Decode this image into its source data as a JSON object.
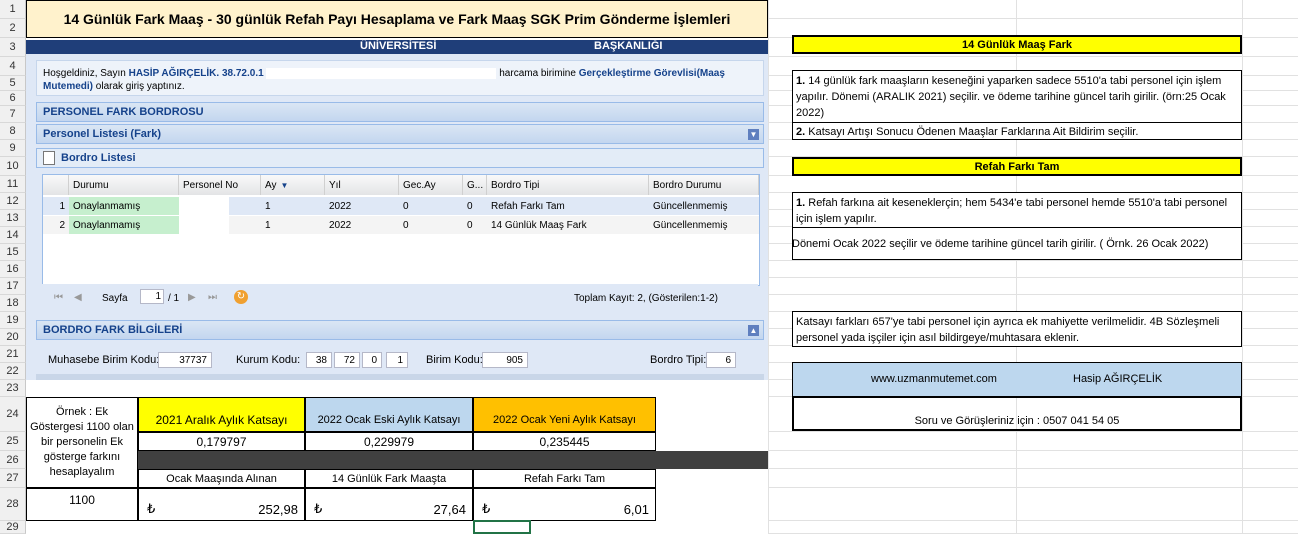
{
  "sheet_title": "14 Günlük Fark Maaş - 30 günlük Refah Payı  Hesaplama ve Fark Maaş SGK Prim Gönderme İşlemleri",
  "row_numbers": [
    "1",
    "2",
    "3",
    "4",
    "5",
    "6",
    "7",
    "8",
    "9",
    "10",
    "11",
    "12",
    "13",
    "14",
    "15",
    "16",
    "17",
    "18",
    "19",
    "20",
    "21",
    "22",
    "23",
    "24",
    "25",
    "26",
    "27",
    "28",
    "29"
  ],
  "screenshot": {
    "top_left": "ÜNİVERSİTESİ",
    "top_right": "BAŞKANLIĞI",
    "welcome_prefix": "Hoşgeldiniz, Sayın",
    "user_name": "HASİP AĞIRÇELİK. 38.72.0.1",
    "welcome_mid": "harcama birimine",
    "role": "Gerçekleştirme Görevlisi(Maaş Mutemedi)",
    "welcome_suffix": "olarak giriş yaptınız.",
    "section1": "PERSONEL FARK BORDROSU",
    "section2": "Personel Listesi (Fark)",
    "section3": "Bordro Listesi",
    "columns": [
      "Durumu",
      "Personel No",
      "Ay",
      "Yıl",
      "Gec.Ay",
      "G...",
      "Bordro Tipi",
      "Bordro Durumu"
    ],
    "rows": [
      {
        "n": "1",
        "durum": "Onaylanmamış",
        "personel": "",
        "ay": "1",
        "yil": "2022",
        "gec": "0",
        "g": "0",
        "tip": "Refah Farkı Tam",
        "bdurum": "Güncellenmemiş"
      },
      {
        "n": "2",
        "durum": "Onaylanmamış",
        "personel": "",
        "ay": "1",
        "yil": "2022",
        "gec": "0",
        "g": "0",
        "tip": "14 Günlük Maaş Fark",
        "bdurum": "Güncellenmemiş"
      }
    ],
    "pager_label": "Sayfa",
    "page_value": "1",
    "page_of": "/ 1",
    "total_text": "Toplam Kayıt: 2, (Gösterilen:1-2)",
    "section4": "BORDRO FARK BİLGİLERİ",
    "muhasebe_label": "Muhasebe Birim Kodu:",
    "muhasebe_value": "37737",
    "kurum_label": "Kurum Kodu:",
    "kurum_values": [
      "38",
      "72",
      "0",
      "1"
    ],
    "birim_label": "Birim Kodu:",
    "birim_value": "905",
    "tipi_label": "Bordro Tipi:",
    "tipi_value": "6"
  },
  "right_panel": {
    "box1_title": "14 Günlük Maaş Fark",
    "box1_item1_num": "1.",
    "box1_item1": " 14 günlük fark maaşların keseneğini yaparken sadece 5510'a tabi personel için işlem yapılır. Dönemi (ARALIK 2021) seçilir. ve ödeme tarihine güncel tarih girilir. (örn:25 Ocak 2022)",
    "box1_item2_num": "2.",
    "box1_item2": " Katsayı Artışı Sonucu Ödenen Maaşlar Farklarına Ait Bildirim seçilir.",
    "box2_title": "Refah Farkı Tam",
    "box2_item1_num": "1.",
    "box2_item1": " Refah farkına ait keseneklerçin; hem 5434'e tabi personel hemde 5510'a tabi personel için işlem yapılır.",
    "box2_item2": "Dönemi Ocak 2022 seçilir ve ödeme tarihine güncel tarih girilir. ( Örnk. 26 Ocak 2022)",
    "box3": "Katsayı farkları 657'ye tabi personel için ayrıca ek mahiyette verilmelidir. 4B Sözleşmeli personel yada işçiler için asıl bildirgeye/muhtasara eklenir.",
    "website": "www.uzmanmutemet.com",
    "author": "Hasip AĞIRÇELİK",
    "contact": "Soru ve Görüşleriniz için : 0507 041 54 05"
  },
  "calc": {
    "example_text": "Örnek : Ek Göstergesi 1100 olan bir personelin Ek gösterge farkını hesaplayalım",
    "h1": "2021 Aralık Aylık Katsayı",
    "h2": "2022 Ocak Eski Aylık Katsayı",
    "h3": "2022 Ocak Yeni Aylık Katsayı",
    "v1": "0,179797",
    "v2": "0,229979",
    "v3": "0,235445",
    "l1": "Ocak Maaşında Alınan",
    "l2": "14 Günlük Fark Maaşta",
    "l3": "Refah Farkı Tam",
    "currency": "₺",
    "m1": "252,98",
    "m2": "27,64",
    "m3": "6,01",
    "example_value": "1100",
    "colors": {
      "yellow": "#ffff00",
      "blue": "#bdd7ee",
      "orange": "#ffc000",
      "dark": "#404040"
    }
  }
}
